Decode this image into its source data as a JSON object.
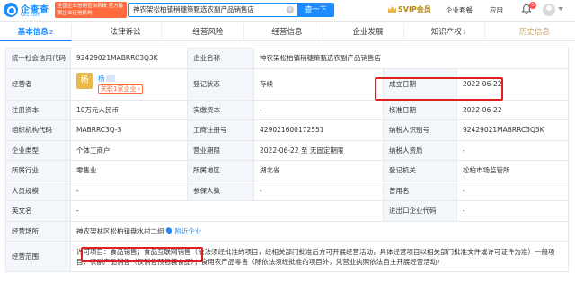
{
  "header": {
    "logo_text": "企查查",
    "logo_sub": "Qcc.com",
    "tagline": "全国企业信用查询系统 官方备案企业征信机构",
    "search_value": "神农架松柏镇稍穗策甄选农副产品销售店",
    "search_button": "查一下",
    "svip_label": "SVIP会员",
    "enterprise_label": "企业套餐",
    "app_label": "应用",
    "notif_count": "5"
  },
  "tabs": [
    {
      "label": "基本信息",
      "count": "2"
    },
    {
      "label": "法律诉讼",
      "count": ""
    },
    {
      "label": "经营风险",
      "count": ""
    },
    {
      "label": "经营信息",
      "count": ""
    },
    {
      "label": "企业发展",
      "count": ""
    },
    {
      "label": "知识产权",
      "count": "1"
    },
    {
      "label": "历史信息",
      "count": ""
    }
  ],
  "rows": {
    "credit_code_label": "统一社会信用代码",
    "credit_code": "92429021MABRRC3Q3K",
    "company_name_label": "企业名称",
    "company_name": "神农架松柏镇稍穗策甄选农副产品销售店",
    "operator_label": "经营者",
    "operator_avatar": "杨",
    "operator_name": "杨",
    "operator_related": "关联1家企业 ›",
    "reg_status_label": "登记状态",
    "reg_status": "存续",
    "founded_label": "成立日期",
    "founded": "2022-06-22",
    "reg_capital_label": "注册资本",
    "reg_capital": "10万元人民币",
    "paid_capital_label": "实缴资本",
    "paid_capital": "-",
    "approved_label": "核准日期",
    "approved": "2022-06-22",
    "org_code_label": "组织机构代码",
    "org_code": "MABRRC3Q-3",
    "biz_reg_label": "工商注册号",
    "biz_reg": "429021600172551",
    "taxpayer_id_label": "纳税人识别号",
    "taxpayer_id": "92429021MABRRC3Q3K",
    "company_type_label": "企业类型",
    "company_type": "个体工商户",
    "term_label": "营业期限",
    "term": "2022-06-22 至 无固定期限",
    "taxpayer_q_label": "纳税人资质",
    "taxpayer_q": "-",
    "industry_label": "所属行业",
    "industry": "零售业",
    "region_label": "所属地区",
    "region": "湖北省",
    "authority_label": "登记机关",
    "authority": "松柏市场监管所",
    "staff_label": "人员规模",
    "staff": "-",
    "insured_label": "参保人数",
    "insured": "-",
    "former_label": "曾用名",
    "former": "-",
    "en_name_label": "英文名",
    "en_name": "-",
    "import_label": "进出口企业代码",
    "import": "-",
    "address_label": "经营场所",
    "address": "神农架林区松柏镇盘水村二组",
    "nearby": "附近企业",
    "scope_label": "经营范围",
    "scope": "许可项目：食品销售；食品互联网销售（依法须经批准的项目，经相关部门批准后方可开展经营活动，具体经营项目以相关部门批准文件或许可证件为准）一般项目：农副产品销售（仅销售预包装食品）；食用农产品零售（除依法须经批准的项目外，凭营业执照依法自主开展经营活动）"
  },
  "colors": {
    "brand": "#1a8cff",
    "highlight": "#e02020",
    "label_bg": "#f3f7fb"
  }
}
